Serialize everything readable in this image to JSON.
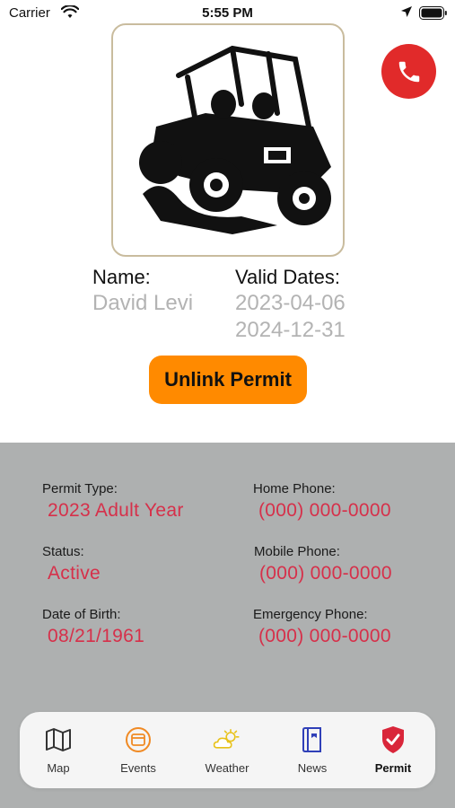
{
  "status_bar": {
    "carrier": "Carrier",
    "time": "5:55 PM"
  },
  "permit": {
    "name_label": "Name:",
    "name_value": "David Levi",
    "dates_label": "Valid Dates:",
    "date_start": "2023-04-06",
    "date_end": "2024-12-31",
    "image_icon": "utv-vehicle-icon",
    "call_icon": "phone-icon",
    "unlink_label": "Unlink Permit"
  },
  "details": {
    "permit_type_label": "Permit Type:",
    "permit_type_value": "2023 Adult Year",
    "status_label": "Status:",
    "status_value": "Active",
    "dob_label": "Date of Birth:",
    "dob_value": "08/21/1961",
    "home_phone_label": "Home Phone:",
    "home_phone_value": "(000) 000-0000",
    "mobile_phone_label": "Mobile Phone:",
    "mobile_phone_value": "(000) 000-0000",
    "emergency_phone_label": "Emergency Phone:",
    "emergency_phone_value": "(000) 000-0000"
  },
  "tabs": [
    {
      "label": "Map",
      "icon": "map-icon",
      "active": false
    },
    {
      "label": "Events",
      "icon": "calendar-icon",
      "active": false
    },
    {
      "label": "Weather",
      "icon": "weather-sun-cloud-icon",
      "active": false
    },
    {
      "label": "News",
      "icon": "news-book-icon",
      "active": false
    },
    {
      "label": "Permit",
      "icon": "shield-check-icon",
      "active": true
    }
  ],
  "colors": {
    "call_button": "#e12a2a",
    "unlink_button": "#ff8a00",
    "detail_value": "#d6304a",
    "panel_bg": "#aeb0b0"
  }
}
